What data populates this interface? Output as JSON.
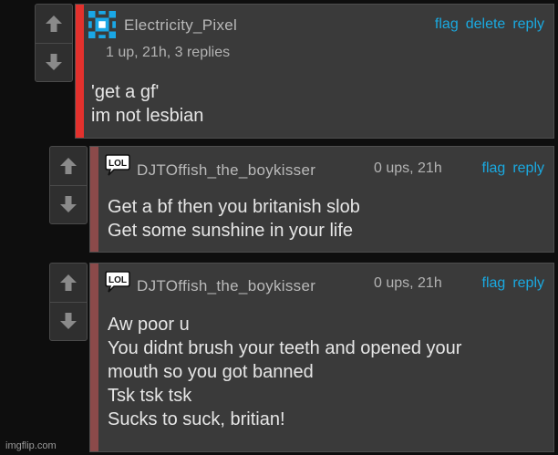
{
  "icons": {
    "upvote": "up-arrow-icon",
    "downvote": "down-arrow-icon",
    "avatar_pixel": "pixel-avatar-icon",
    "avatar_lol": "lol-speech-bubble-icon"
  },
  "colors": {
    "background": "#0e0e0e",
    "panel": "#3a3a3a",
    "stripe_op": "#e3312d",
    "stripe_reply": "#8b4a4a",
    "link": "#1aa9e0",
    "pixel_avatar": "#1aa7e6"
  },
  "comments": [
    {
      "username": "Electricity_Pixel",
      "meta": "1 up, 21h, 3 replies",
      "actions": {
        "flag": "flag",
        "delete": "delete",
        "reply": "reply"
      },
      "lines": [
        "'get a gf'",
        "im not lesbian"
      ]
    },
    {
      "username": "DJTOffish_the_boykisser",
      "meta": "0 ups, 21h",
      "actions": {
        "flag": "flag",
        "reply": "reply"
      },
      "lines": [
        "Get a bf then you britanish slob",
        "Get some sunshine in your life"
      ]
    },
    {
      "username": "DJTOffish_the_boykisser",
      "meta": "0 ups, 21h",
      "actions": {
        "flag": "flag",
        "reply": "reply"
      },
      "lines": [
        "Aw poor u",
        "You didnt brush your teeth and opened your",
        "mouth so you got banned",
        "Tsk tsk tsk",
        "Sucks to suck, britian!"
      ]
    }
  ],
  "watermark": "imgflip.com"
}
